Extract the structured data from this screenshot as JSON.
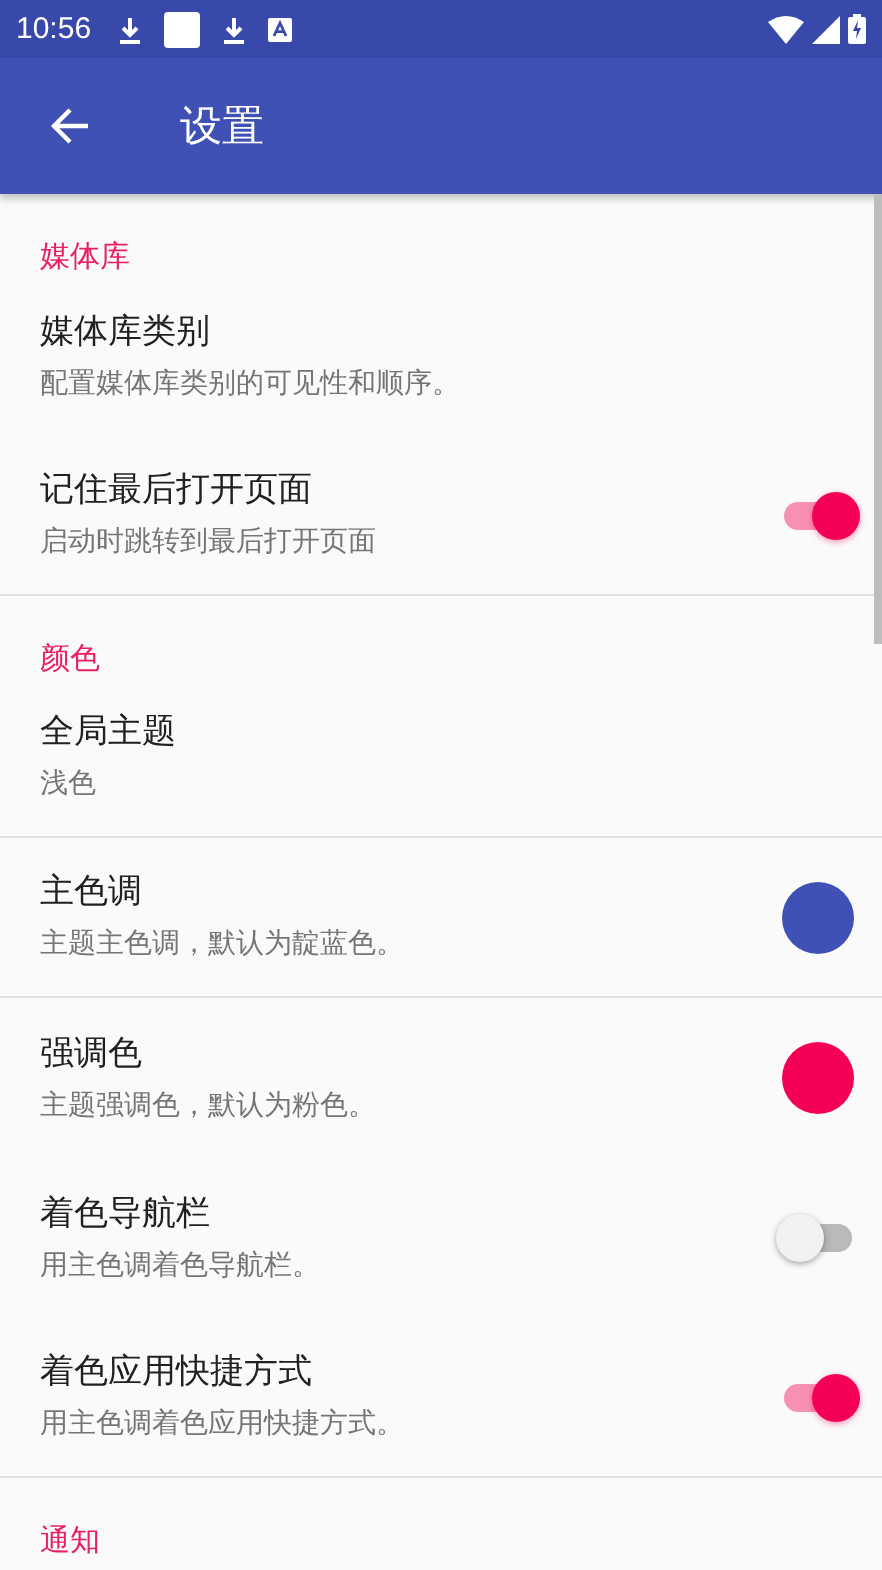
{
  "status_bar": {
    "time": "10:56"
  },
  "app_bar": {
    "title": "设置"
  },
  "sections": [
    {
      "title": "媒体库",
      "items": [
        {
          "kind": "plain",
          "title": "媒体库类别",
          "summary": "配置媒体库类别的可见性和顺序。",
          "divider_below": false
        },
        {
          "kind": "switch",
          "title": "记住最后打开页面",
          "summary": "启动时跳转到最后打开页面",
          "on": true,
          "divider_below": true
        }
      ]
    },
    {
      "title": "颜色",
      "items": [
        {
          "kind": "plain",
          "title": "全局主题",
          "summary": "浅色",
          "divider_below": true
        },
        {
          "kind": "color",
          "title": "主色调",
          "summary": "主题主色调，默认为靛蓝色。",
          "color": "#3f51b5",
          "divider_below": true
        },
        {
          "kind": "color",
          "title": "强调色",
          "summary": "主题强调色，默认为粉色。",
          "color": "#f50057",
          "divider_below": false
        },
        {
          "kind": "switch",
          "title": "着色导航栏",
          "summary": "用主色调着色导航栏。",
          "on": false,
          "divider_below": false
        },
        {
          "kind": "switch",
          "title": "着色应用快捷方式",
          "summary": "用主色调着色应用快捷方式。",
          "on": true,
          "divider_below": true
        }
      ]
    },
    {
      "title": "通知"
    }
  ]
}
